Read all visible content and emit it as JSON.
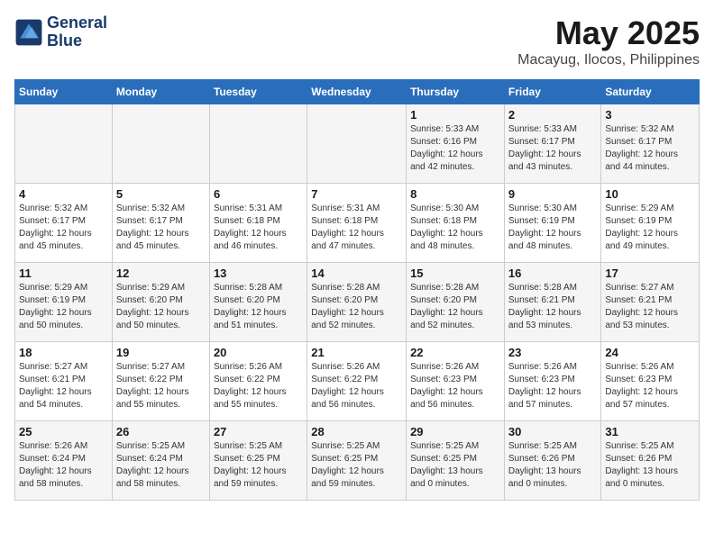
{
  "header": {
    "logo_line1": "General",
    "logo_line2": "Blue",
    "month_year": "May 2025",
    "location": "Macayug, Ilocos, Philippines"
  },
  "weekdays": [
    "Sunday",
    "Monday",
    "Tuesday",
    "Wednesday",
    "Thursday",
    "Friday",
    "Saturday"
  ],
  "weeks": [
    [
      {
        "date": "",
        "info": ""
      },
      {
        "date": "",
        "info": ""
      },
      {
        "date": "",
        "info": ""
      },
      {
        "date": "",
        "info": ""
      },
      {
        "date": "1",
        "info": "Sunrise: 5:33 AM\nSunset: 6:16 PM\nDaylight: 12 hours\nand 42 minutes."
      },
      {
        "date": "2",
        "info": "Sunrise: 5:33 AM\nSunset: 6:17 PM\nDaylight: 12 hours\nand 43 minutes."
      },
      {
        "date": "3",
        "info": "Sunrise: 5:32 AM\nSunset: 6:17 PM\nDaylight: 12 hours\nand 44 minutes."
      }
    ],
    [
      {
        "date": "4",
        "info": "Sunrise: 5:32 AM\nSunset: 6:17 PM\nDaylight: 12 hours\nand 45 minutes."
      },
      {
        "date": "5",
        "info": "Sunrise: 5:32 AM\nSunset: 6:17 PM\nDaylight: 12 hours\nand 45 minutes."
      },
      {
        "date": "6",
        "info": "Sunrise: 5:31 AM\nSunset: 6:18 PM\nDaylight: 12 hours\nand 46 minutes."
      },
      {
        "date": "7",
        "info": "Sunrise: 5:31 AM\nSunset: 6:18 PM\nDaylight: 12 hours\nand 47 minutes."
      },
      {
        "date": "8",
        "info": "Sunrise: 5:30 AM\nSunset: 6:18 PM\nDaylight: 12 hours\nand 48 minutes."
      },
      {
        "date": "9",
        "info": "Sunrise: 5:30 AM\nSunset: 6:19 PM\nDaylight: 12 hours\nand 48 minutes."
      },
      {
        "date": "10",
        "info": "Sunrise: 5:29 AM\nSunset: 6:19 PM\nDaylight: 12 hours\nand 49 minutes."
      }
    ],
    [
      {
        "date": "11",
        "info": "Sunrise: 5:29 AM\nSunset: 6:19 PM\nDaylight: 12 hours\nand 50 minutes."
      },
      {
        "date": "12",
        "info": "Sunrise: 5:29 AM\nSunset: 6:20 PM\nDaylight: 12 hours\nand 50 minutes."
      },
      {
        "date": "13",
        "info": "Sunrise: 5:28 AM\nSunset: 6:20 PM\nDaylight: 12 hours\nand 51 minutes."
      },
      {
        "date": "14",
        "info": "Sunrise: 5:28 AM\nSunset: 6:20 PM\nDaylight: 12 hours\nand 52 minutes."
      },
      {
        "date": "15",
        "info": "Sunrise: 5:28 AM\nSunset: 6:20 PM\nDaylight: 12 hours\nand 52 minutes."
      },
      {
        "date": "16",
        "info": "Sunrise: 5:28 AM\nSunset: 6:21 PM\nDaylight: 12 hours\nand 53 minutes."
      },
      {
        "date": "17",
        "info": "Sunrise: 5:27 AM\nSunset: 6:21 PM\nDaylight: 12 hours\nand 53 minutes."
      }
    ],
    [
      {
        "date": "18",
        "info": "Sunrise: 5:27 AM\nSunset: 6:21 PM\nDaylight: 12 hours\nand 54 minutes."
      },
      {
        "date": "19",
        "info": "Sunrise: 5:27 AM\nSunset: 6:22 PM\nDaylight: 12 hours\nand 55 minutes."
      },
      {
        "date": "20",
        "info": "Sunrise: 5:26 AM\nSunset: 6:22 PM\nDaylight: 12 hours\nand 55 minutes."
      },
      {
        "date": "21",
        "info": "Sunrise: 5:26 AM\nSunset: 6:22 PM\nDaylight: 12 hours\nand 56 minutes."
      },
      {
        "date": "22",
        "info": "Sunrise: 5:26 AM\nSunset: 6:23 PM\nDaylight: 12 hours\nand 56 minutes."
      },
      {
        "date": "23",
        "info": "Sunrise: 5:26 AM\nSunset: 6:23 PM\nDaylight: 12 hours\nand 57 minutes."
      },
      {
        "date": "24",
        "info": "Sunrise: 5:26 AM\nSunset: 6:23 PM\nDaylight: 12 hours\nand 57 minutes."
      }
    ],
    [
      {
        "date": "25",
        "info": "Sunrise: 5:26 AM\nSunset: 6:24 PM\nDaylight: 12 hours\nand 58 minutes."
      },
      {
        "date": "26",
        "info": "Sunrise: 5:25 AM\nSunset: 6:24 PM\nDaylight: 12 hours\nand 58 minutes."
      },
      {
        "date": "27",
        "info": "Sunrise: 5:25 AM\nSunset: 6:25 PM\nDaylight: 12 hours\nand 59 minutes."
      },
      {
        "date": "28",
        "info": "Sunrise: 5:25 AM\nSunset: 6:25 PM\nDaylight: 12 hours\nand 59 minutes."
      },
      {
        "date": "29",
        "info": "Sunrise: 5:25 AM\nSunset: 6:25 PM\nDaylight: 13 hours\nand 0 minutes."
      },
      {
        "date": "30",
        "info": "Sunrise: 5:25 AM\nSunset: 6:26 PM\nDaylight: 13 hours\nand 0 minutes."
      },
      {
        "date": "31",
        "info": "Sunrise: 5:25 AM\nSunset: 6:26 PM\nDaylight: 13 hours\nand 0 minutes."
      }
    ]
  ]
}
